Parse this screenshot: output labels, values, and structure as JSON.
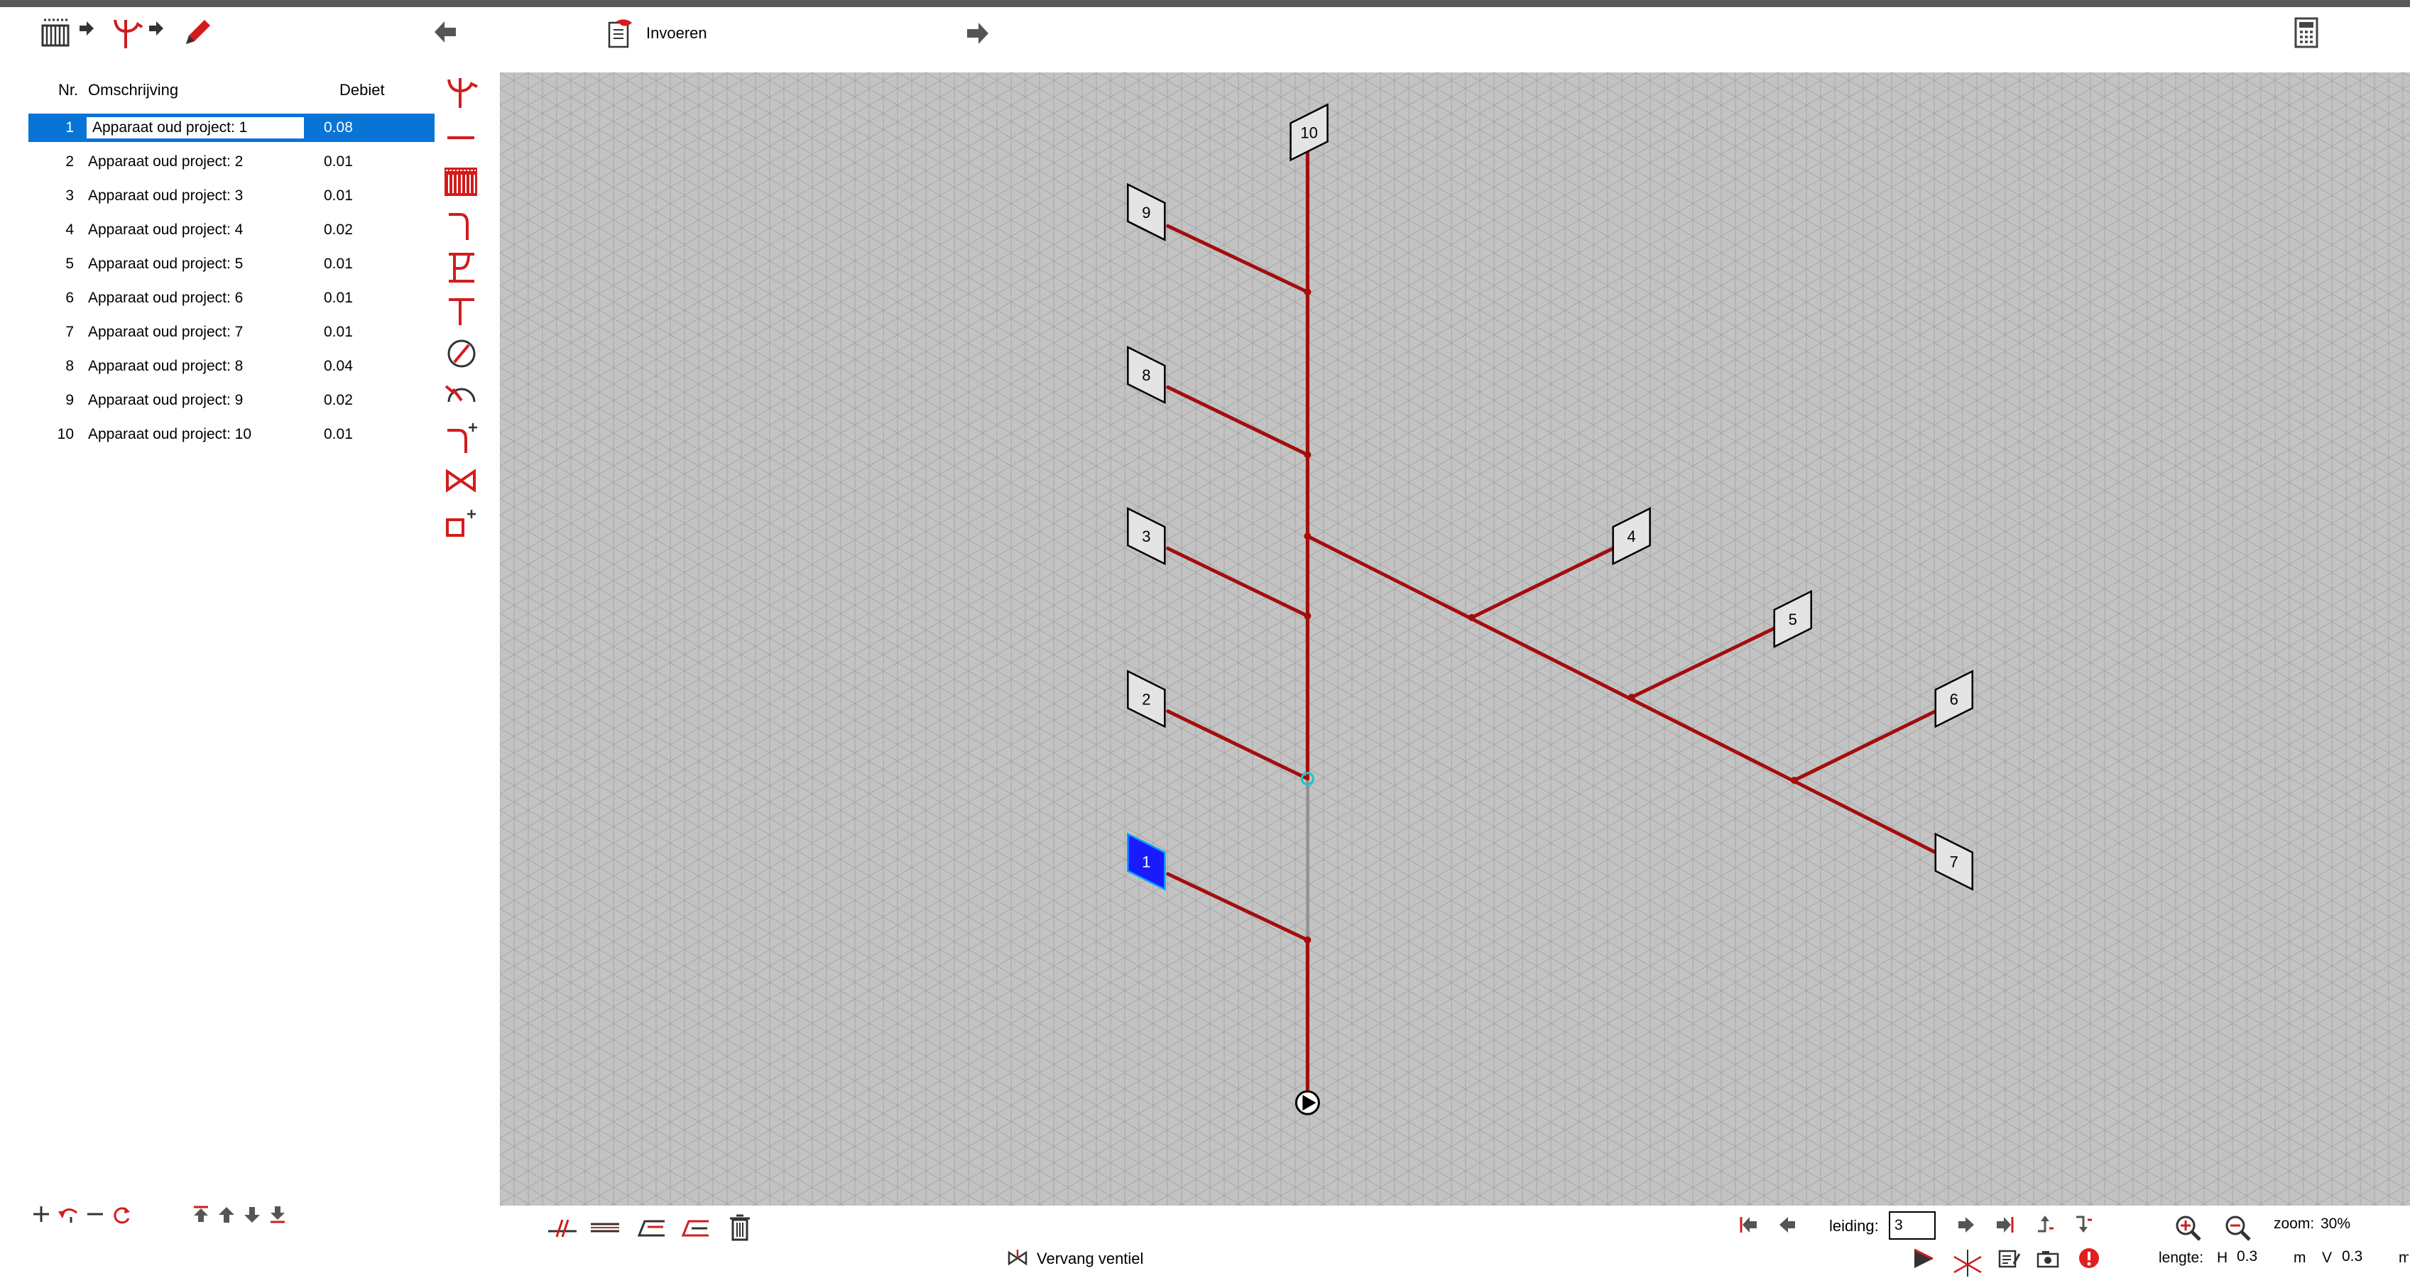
{
  "toolbar": {
    "invoeren_label": "Invoeren"
  },
  "list": {
    "headers": {
      "nr": "Nr.",
      "description": "Omschrijving",
      "debiet": "Debiet"
    },
    "rows": [
      {
        "nr": "1",
        "description": "Apparaat oud project: 1",
        "debiet": "0.08",
        "selected": true
      },
      {
        "nr": "2",
        "description": "Apparaat oud project: 2",
        "debiet": "0.01"
      },
      {
        "nr": "3",
        "description": "Apparaat oud project: 3",
        "debiet": "0.01"
      },
      {
        "nr": "4",
        "description": "Apparaat oud project: 4",
        "debiet": "0.02"
      },
      {
        "nr": "5",
        "description": "Apparaat oud project: 5",
        "debiet": "0.01"
      },
      {
        "nr": "6",
        "description": "Apparaat oud project: 6",
        "debiet": "0.01"
      },
      {
        "nr": "7",
        "description": "Apparaat oud project: 7",
        "debiet": "0.01"
      },
      {
        "nr": "8",
        "description": "Apparaat oud project: 8",
        "debiet": "0.04"
      },
      {
        "nr": "9",
        "description": "Apparaat oud project: 9",
        "debiet": "0.02"
      },
      {
        "nr": "10",
        "description": "Apparaat oud project: 10",
        "debiet": "0.01"
      }
    ]
  },
  "diagram": {
    "nodes": [
      "10",
      "9",
      "8",
      "3",
      "2",
      "1",
      "4",
      "5",
      "6",
      "7"
    ]
  },
  "bottom": {
    "vervang_label": "Vervang ventiel",
    "leiding_label": "leiding:",
    "leiding_value": "3",
    "zoom_label": "zoom:",
    "zoom_value": "30%",
    "lengte_label": "lengte:",
    "h_label": "H",
    "h_value": "0.3",
    "h_unit": "m",
    "v_label": "V",
    "v_value": "0.3",
    "v_unit": "m"
  },
  "colors": {
    "pipe": "#a30d0d",
    "accent_red": "#e02020",
    "selection": "#0a74d6",
    "canvas": "#c3c3c3",
    "grid": "#9d9d9d"
  }
}
